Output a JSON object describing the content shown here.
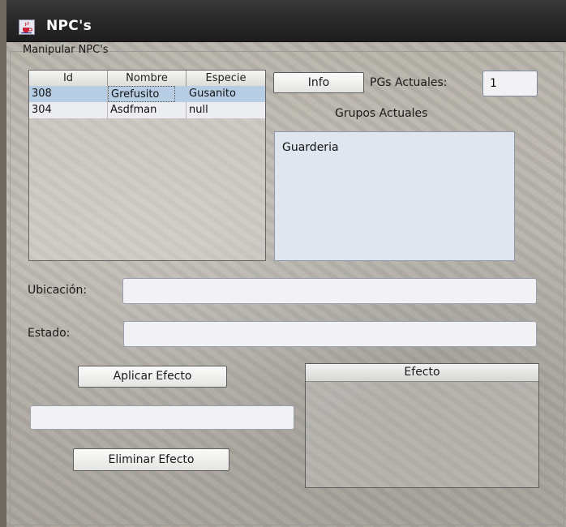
{
  "window": {
    "title": "NPC's"
  },
  "panel": {
    "title": "Manipular NPC's"
  },
  "npc_table": {
    "columns": [
      "Id",
      "Nombre",
      "Especie"
    ],
    "rows": [
      {
        "id": "308",
        "nombre": "Grefusito",
        "especie": "Gusanito",
        "selected": true
      },
      {
        "id": "304",
        "nombre": "Asdfman",
        "especie": "null",
        "selected": false
      }
    ]
  },
  "info_button": {
    "label": "Info"
  },
  "pgs": {
    "label": "PGs Actuales:",
    "value": "1"
  },
  "grupos": {
    "label": "Grupos Actuales",
    "items": [
      "Guarderia"
    ]
  },
  "ubicacion": {
    "label": "Ubicación:",
    "value": ""
  },
  "estado": {
    "label": "Estado:",
    "value": ""
  },
  "aplicar_button": {
    "label": "Aplicar Efecto"
  },
  "efecto_input": {
    "value": ""
  },
  "eliminar_button": {
    "label": "Eliminar Efecto"
  },
  "efecto_table": {
    "header": "Efecto"
  },
  "colors": {
    "selected_row": "#b7cde3",
    "title_bar": "#2b2b2b"
  },
  "icons": {
    "window": "java-cup-icon"
  }
}
